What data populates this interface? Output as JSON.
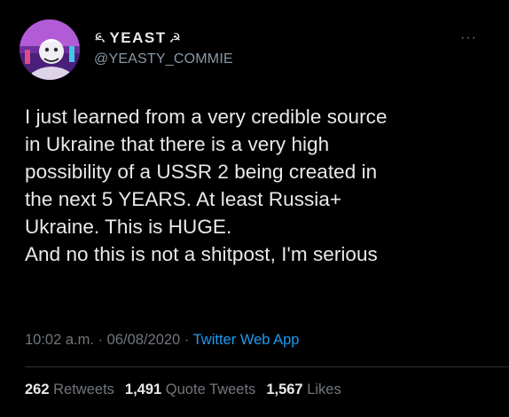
{
  "author": {
    "display_name": "YEAST",
    "name_symbol": "☭",
    "handle": "@YEASTY_COMMIE",
    "avatar_icon": "avatar-cartoon-character-icon"
  },
  "more_label": "···",
  "tweet": {
    "lines": [
      "I just learned from a very credible source",
      "in Ukraine that there is a very high",
      "possibility of a USSR 2 being created in",
      "the next 5 YEARS. At least Russia+",
      "Ukraine. This is HUGE.",
      "And no this is not a shitpost, I'm serious"
    ]
  },
  "meta": {
    "time": "10:02 a.m.",
    "separator": "·",
    "date": "06/08/2020",
    "source": "Twitter Web App"
  },
  "stats": {
    "retweets_count": "262",
    "retweets_label": "Retweets",
    "quote_count": "1,491",
    "quote_label": "Quote Tweets",
    "likes_count": "1,567",
    "likes_label": "Likes"
  },
  "colors": {
    "background": "#000000",
    "text": "#e7e9ea",
    "secondary": "#71767b",
    "link": "#1d9bf0"
  }
}
